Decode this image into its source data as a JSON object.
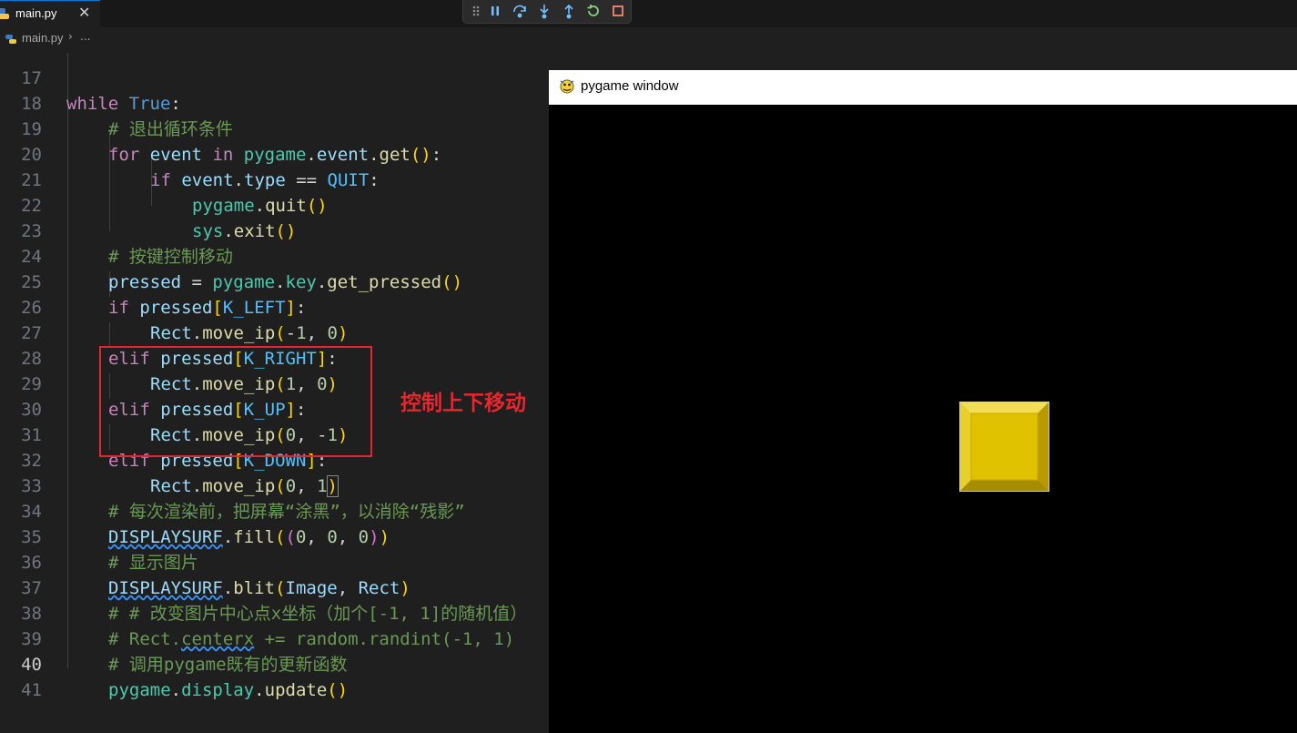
{
  "tab": {
    "filename": "main.py",
    "close_glyph": "✕"
  },
  "debug_toolbar": {
    "icons": [
      "drag-handle-icon",
      "pause-icon",
      "step-over-icon",
      "step-into-icon",
      "step-out-icon",
      "restart-icon",
      "stop-icon"
    ]
  },
  "breadcrumb": {
    "file": "main.py",
    "separator": "›",
    "more": "..."
  },
  "editor": {
    "active_line": "40",
    "lines": [
      {
        "n": "17",
        "text": "while True:"
      },
      {
        "n": "18",
        "text": "# 退出循环条件"
      },
      {
        "n": "19",
        "text": "for event in pygame.event.get():"
      },
      {
        "n": "20",
        "text": "if event.type == QUIT:"
      },
      {
        "n": "21",
        "text": "pygame.quit()"
      },
      {
        "n": "22",
        "text": "sys.exit()"
      },
      {
        "n": "23",
        "text": "# 按键控制移动"
      },
      {
        "n": "24",
        "text": "pressed = pygame.key.get_pressed()"
      },
      {
        "n": "25",
        "text": "if pressed[K_LEFT]:"
      },
      {
        "n": "26",
        "text": "Rect.move_ip(-1, 0)"
      },
      {
        "n": "27",
        "text": "elif pressed[K_RIGHT]:"
      },
      {
        "n": "28",
        "text": "Rect.move_ip(1, 0)"
      },
      {
        "n": "29",
        "text": "elif pressed[K_UP]:"
      },
      {
        "n": "30",
        "text": "Rect.move_ip(0, -1)"
      },
      {
        "n": "31",
        "text": "elif pressed[K_DOWN]:"
      },
      {
        "n": "32",
        "text": "Rect.move_ip(0, 1)"
      },
      {
        "n": "33",
        "text": "# 每次渲染前，把屏幕“涂黑”，以消除“残影”"
      },
      {
        "n": "34",
        "text": "DISPLAYSURF.fill((0, 0, 0))"
      },
      {
        "n": "35",
        "text": "# 显示图片"
      },
      {
        "n": "36",
        "text": "DISPLAYSURF.blit(Image, Rect)"
      },
      {
        "n": "37",
        "text": "# # 改变图片中心点x坐标（加个[-1, 1]的随机值）"
      },
      {
        "n": "38",
        "text": "# Rect.centerx += random.randint(-1, 1)"
      },
      {
        "n": "39",
        "text": "# 调用pygame既有的更新函数"
      },
      {
        "n": "40",
        "text": "pygame.display.update()"
      },
      {
        "n": "41",
        "text": ""
      }
    ]
  },
  "annotation": {
    "text": "控制上下移动",
    "color": "#e8262e"
  },
  "pygame_window": {
    "title": "pygame window",
    "block_color": "#e0c200",
    "background": "#000000"
  }
}
